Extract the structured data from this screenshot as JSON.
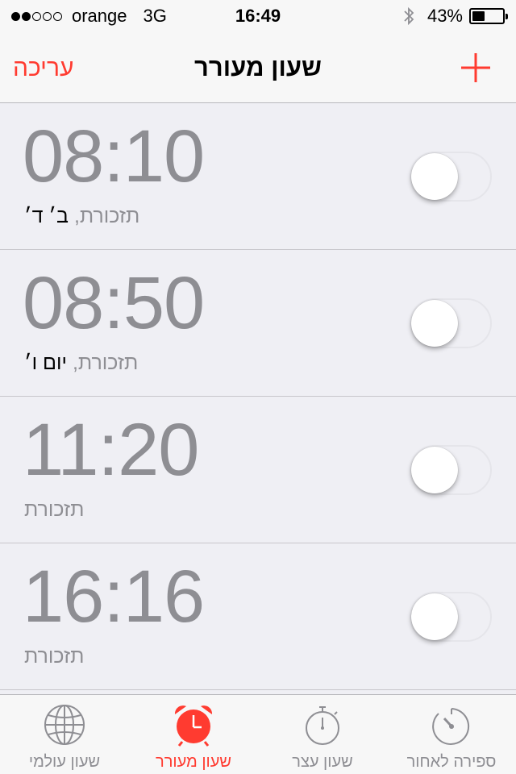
{
  "status_bar": {
    "carrier": "orange",
    "network": "3G",
    "time": "16:49",
    "battery_percent": "43%",
    "battery_level": 0.43,
    "signal_bars_filled": 2,
    "signal_bars_total": 5
  },
  "nav": {
    "title": "שעון מעורר",
    "edit_label": "עריכה",
    "add_icon": "plus-icon"
  },
  "colors": {
    "accent": "#ff3b30",
    "time_text": "#8e8e93",
    "background": "#efeff4"
  },
  "alarms": [
    {
      "time": "08:10",
      "label": "תזכורת",
      "days": "ב׳ ד׳",
      "enabled": false
    },
    {
      "time": "08:50",
      "label": "תזכורת",
      "days": "יום ו׳",
      "enabled": false
    },
    {
      "time": "11:20",
      "label": "תזכורת",
      "days": "",
      "enabled": false
    },
    {
      "time": "16:16",
      "label": "תזכורת",
      "days": "",
      "enabled": false
    }
  ],
  "tabs": [
    {
      "label": "שעון עולמי",
      "icon": "globe-icon",
      "active": false
    },
    {
      "label": "שעון מעורר",
      "icon": "alarm-clock-icon",
      "active": true
    },
    {
      "label": "שעון עצר",
      "icon": "stopwatch-icon",
      "active": false
    },
    {
      "label": "ספירה לאחור",
      "icon": "timer-icon",
      "active": false
    }
  ]
}
